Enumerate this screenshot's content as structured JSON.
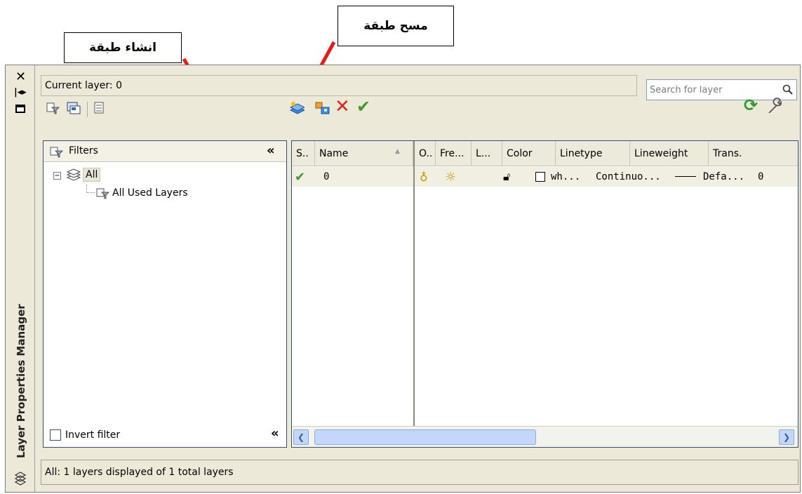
{
  "callouts": {
    "create_layer": "انشاء طبقة",
    "delete_layer": "مسح طبقة"
  },
  "palette": {
    "vertical_title": "Layer Properties Manager",
    "current_layer": "Current layer: 0",
    "search_placeholder": "Search for layer",
    "filters_title": "Filters",
    "tree": {
      "root": "All",
      "child": "All Used Layers"
    },
    "invert_filter": "Invert filter",
    "status_bar": "All: 1 layers displayed of 1 total layers"
  },
  "table": {
    "columns": [
      "S..",
      "Name",
      "O..",
      "Fre...",
      "L...",
      "Color",
      "Linetype",
      "Lineweight",
      "Trans."
    ],
    "rows": [
      {
        "name": "0",
        "color": "wh...",
        "linetype": "Continuo...",
        "lineweight": "Defa...",
        "transparency": "0"
      }
    ]
  },
  "colors": {
    "arrow": "#e41b1b",
    "selected_row": "#f1efe2",
    "scroll_thumb": "#c3d7fb"
  }
}
